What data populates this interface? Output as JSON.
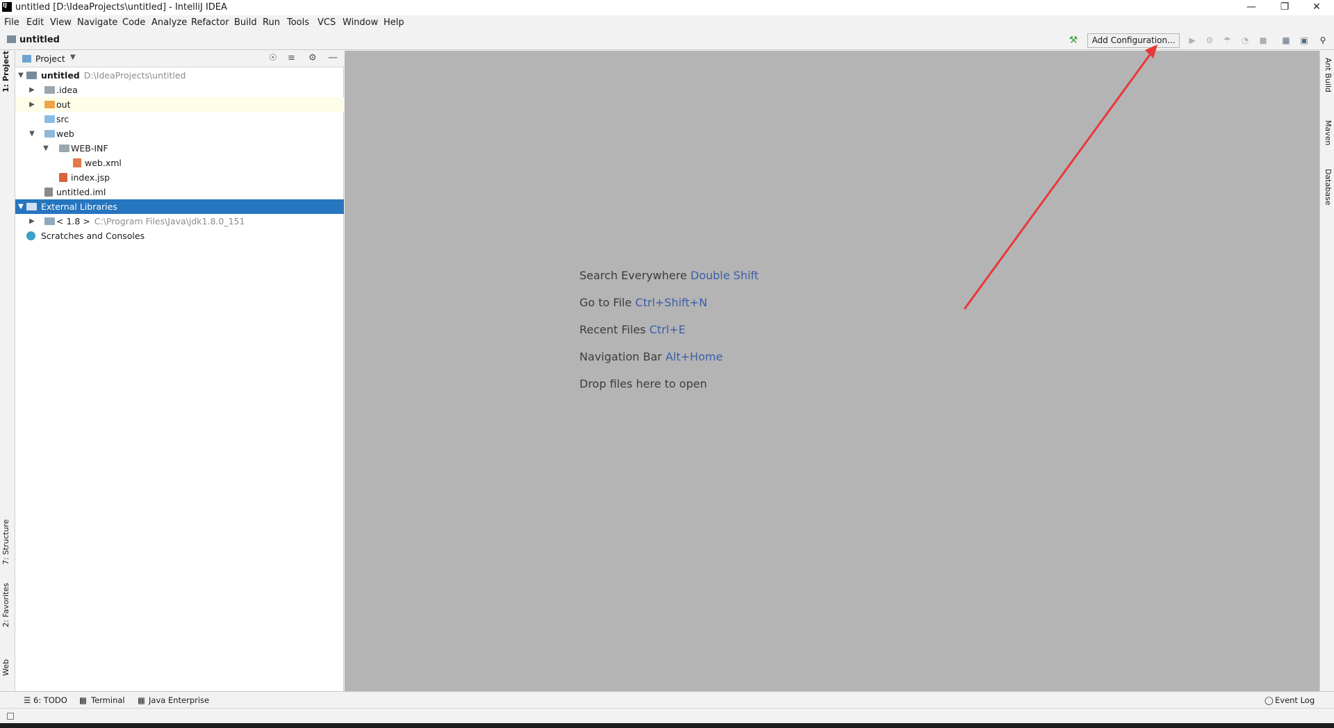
{
  "window": {
    "title": "untitled [D:\\IdeaProjects\\untitled] - IntelliJ IDEA",
    "logo_text": "IJ",
    "minimize": "—",
    "restore": "❐",
    "close": "✕"
  },
  "menu": [
    "File",
    "Edit",
    "View",
    "Navigate",
    "Code",
    "Analyze",
    "Refactor",
    "Build",
    "Run",
    "Tools",
    "VCS",
    "Window",
    "Help"
  ],
  "navbar": {
    "project": "untitled",
    "add_configuration": "Add Configuration...",
    "icons": [
      "build-hammer-icon",
      "run-icon",
      "debug-icon",
      "coverage-icon",
      "profile-icon",
      "stop-icon",
      "project-structure-icon",
      "sdk-icon",
      "search-icon"
    ]
  },
  "left_tabs": [
    "1: Project",
    "7: Structure",
    "2: Favorites",
    "Web"
  ],
  "right_tabs": [
    "Ant Build",
    "Maven",
    "Database"
  ],
  "project_panel": {
    "title": "Project",
    "tree": [
      {
        "label": "untitled",
        "path": "D:\\IdeaProjects\\untitled",
        "level": 0,
        "expanded": true,
        "icon": "module",
        "bold": true
      },
      {
        "label": ".idea",
        "level": 1,
        "expanded": false,
        "icon": "folder-grey"
      },
      {
        "label": "out",
        "level": 1,
        "expanded": false,
        "icon": "folder-orange",
        "highlighted": true
      },
      {
        "label": "src",
        "level": 1,
        "icon": "folder-blue"
      },
      {
        "label": "web",
        "level": 1,
        "expanded": true,
        "icon": "folder-web"
      },
      {
        "label": "WEB-INF",
        "level": 2,
        "expanded": true,
        "icon": "folder-grey"
      },
      {
        "label": "web.xml",
        "level": 3,
        "icon": "xml-file"
      },
      {
        "label": "index.jsp",
        "level": 2,
        "icon": "jsp-file"
      },
      {
        "label": "untitled.iml",
        "level": 1,
        "icon": "iml-file"
      },
      {
        "label": "External Libraries",
        "level": 0,
        "expanded": true,
        "icon": "library",
        "selected": true
      },
      {
        "label": "< 1.8 >",
        "path": "C:\\Program Files\\Java\\jdk1.8.0_151",
        "level": 1,
        "expanded": false,
        "icon": "jdk"
      },
      {
        "label": "Scratches and Consoles",
        "level": 0,
        "icon": "scratches"
      }
    ]
  },
  "editor_hints": [
    {
      "text": "Search Everywhere",
      "key": "Double Shift"
    },
    {
      "text": "Go to File",
      "key": "Ctrl+Shift+N"
    },
    {
      "text": "Recent Files",
      "key": "Ctrl+E"
    },
    {
      "text": "Navigation Bar",
      "key": "Alt+Home"
    },
    {
      "text": "Drop files here to open",
      "key": ""
    }
  ],
  "bottom_tabs": [
    "6: TODO",
    "Terminal",
    "Java Enterprise"
  ],
  "event_log": "Event Log",
  "colors": {
    "selection": "#2675bf",
    "highlight_row": "#fdfde8",
    "editor_bg": "#b4b4b4",
    "hint_key": "#3b5fa8",
    "annotation_arrow": "#e8383a"
  }
}
